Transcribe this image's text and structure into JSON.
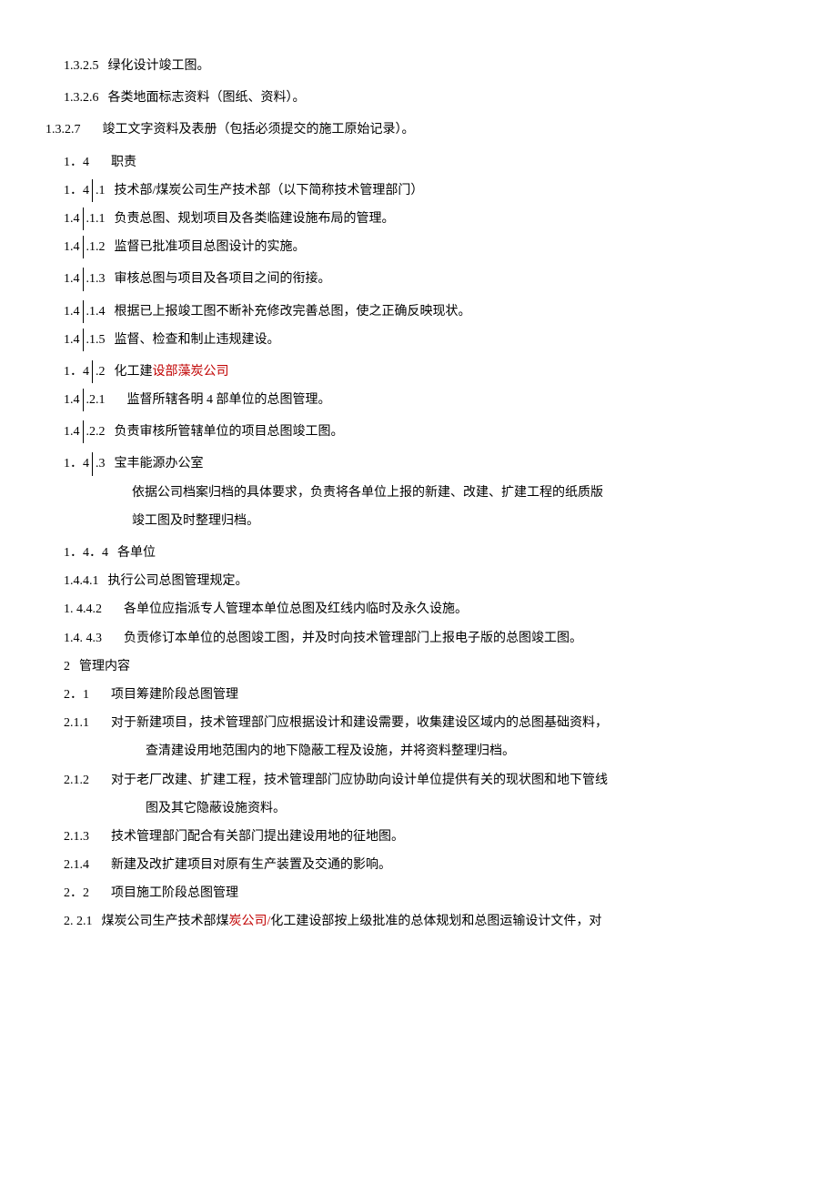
{
  "lines": [
    {
      "cls": "indent-1",
      "num": "1.3.2.5",
      "text": "绿化设计竣工图。"
    },
    {
      "cls": "indent-1 block-spacing",
      "num": "1.3.2.6",
      "text": "各类地面标志资料（图纸、资料）。"
    },
    {
      "cls": "indent-2 block-spacing",
      "num": "1.3.2.7",
      "numCls": "num-wide",
      "text": "竣工文字资料及表册（包括必须提交的施工原始记录）。"
    },
    {
      "cls": "indent-1 block-spacing",
      "num": "1．4",
      "numCls": "num-wide",
      "text": "职责"
    },
    {
      "cls": "indent-1",
      "num": "1．4",
      "numWithBorder": ".1",
      "text": "技术部/煤炭公司生产技术部（以下简称技术管理部门）"
    },
    {
      "cls": "indent-1",
      "num": "1.4",
      "numWithBorder": ".1.1",
      "text": "负责总图、规划项目及各类临建设施布局的管理。"
    },
    {
      "cls": "indent-1",
      "num": "1.4",
      "numWithBorder": ".1.2",
      "text": "监督已批准项目总图设计的实施。"
    },
    {
      "cls": "indent-1 block-spacing",
      "num": "1.4",
      "numWithBorder": ".1.3",
      "text": "审核总图与项目及各项目之间的衔接。"
    },
    {
      "cls": "indent-1 block-spacing",
      "num": "1.4",
      "numWithBorder": ".1.4",
      "text": "根据已上报竣工图不断补充修改完善总图，使之正确反映现状。"
    },
    {
      "cls": "indent-1",
      "num": "1.4",
      "numWithBorder": ".1.5",
      "text": "监督、检查和制止违规建设。"
    },
    {
      "cls": "indent-1 block-spacing",
      "num": "1．4",
      "numWithBorder": ".2",
      "text": "化工建",
      "textRed": "设部藻炭公司"
    },
    {
      "cls": "indent-1",
      "num": "1.4",
      "numWithBorder": ".2.1",
      "numCls2": "num-wide",
      "text": "监督所辖各明 4 部单位的总图管理。"
    },
    {
      "cls": "indent-1 block-spacing",
      "num": "1.4",
      "numWithBorder": ".2.2",
      "text": "负责审核所管辖单位的项目总图竣工图。"
    },
    {
      "cls": "indent-1 block-spacing",
      "num": "1．4",
      "numWithBorder": ".3",
      "text": "宝丰能源办公室"
    },
    {
      "cls": "body-text-indent",
      "text": "依据公司档案归档的具体要求，负责将各单位上报的新建、改建、扩建工程的纸质版"
    },
    {
      "cls": "body-text-indent",
      "text": "竣工图及时整理归档。"
    },
    {
      "cls": "indent-1 block-spacing",
      "num": "1．4．4",
      "text": "各单位"
    },
    {
      "cls": "indent-1",
      "num": "1.4.4.1",
      "text": "执行公司总图管理规定。"
    },
    {
      "cls": "indent-1",
      "num": "1.   4.4.2",
      "numCls": "num-wide",
      "text": "各单位应指派专人管理本单位总图及红线内临时及永久设施。"
    },
    {
      "cls": "indent-1",
      "num": "1.4.     4.3",
      "numCls": "num-wide",
      "text": "负贡修订本单位的总图竣工图，并及时向技术管理部门上报电子版的总图竣工图。"
    },
    {
      "cls": "indent-1",
      "num": "2",
      "text": "管理内容"
    },
    {
      "cls": "indent-1",
      "num": "2．1",
      "numCls": "num-wide",
      "text": "项目筹建阶段总图管理"
    },
    {
      "cls": "indent-1",
      "num": "2.1.1",
      "numCls": "num-wide",
      "text": "对于新建项目，技术管理部门应根据设计和建设需要，收集建设区域内的总图基础资料，"
    },
    {
      "cls": "body-text-indent-2",
      "text": "查清建设用地范围内的地下隐蔽工程及设施，并将资料整理归档。"
    },
    {
      "cls": "indent-1",
      "num": "2.1.2",
      "numCls": "num-wide",
      "text": "对于老厂改建、扩建工程，技术管理部门应协助向设计单位提供有关的现状图和地下管线"
    },
    {
      "cls": "body-text-indent-2",
      "text": "图及其它隐蔽设施资料。"
    },
    {
      "cls": "indent-1",
      "num": "2.1.3",
      "numCls": "num-wide",
      "text": "技术管理部门配合有关部门提出建设用地的征地图。"
    },
    {
      "cls": "indent-1",
      "num": "2.1.4",
      "numCls": "num-wide",
      "text": "新建及改扩建项目对原有生产装置及交通的影响。"
    },
    {
      "cls": "indent-1",
      "num": "2．2",
      "numCls": "num-wide",
      "text": "项目施工阶段总图管理"
    },
    {
      "cls": "indent-1",
      "num": "2.    2.1",
      "text": "煤炭公司生产技术部煤",
      "textRed": "炭公司/",
      "textAfter": "化工建设部按上级批准的总体规划和总图运输设计文件，对"
    }
  ]
}
